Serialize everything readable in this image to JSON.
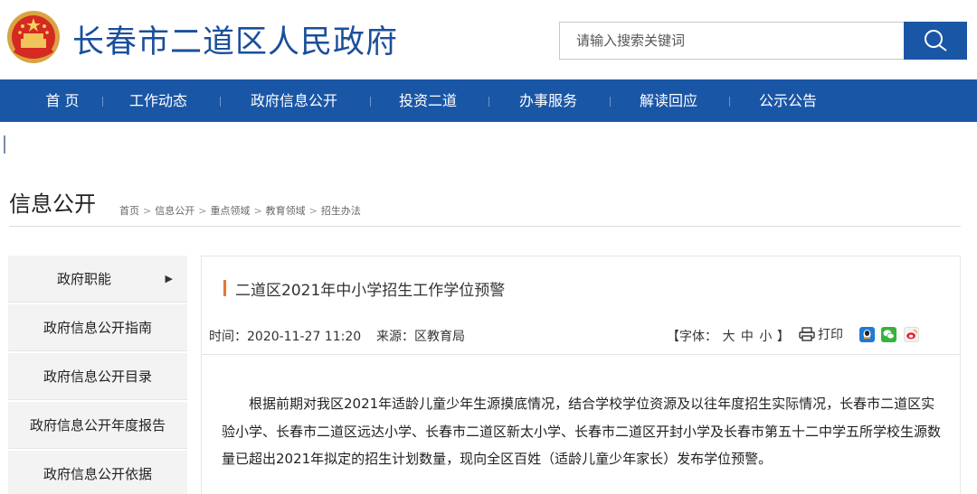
{
  "header": {
    "site_title": "长春市二道区人民政府",
    "search_placeholder": "请输入搜索关键词"
  },
  "nav": [
    {
      "label": "首 页"
    },
    {
      "label": "工作动态"
    },
    {
      "label": "政府信息公开"
    },
    {
      "label": "投资二道"
    },
    {
      "label": "办事服务"
    },
    {
      "label": "解读回应"
    },
    {
      "label": "公示公告"
    }
  ],
  "section": {
    "title": "信息公开",
    "breadcrumb": [
      "首页",
      "信息公开",
      "重点领域",
      "教育领域",
      "招生办法"
    ],
    "breadcrumb_sep": ">"
  },
  "sidebar": [
    {
      "label": "政府职能",
      "arrow": "▶"
    },
    {
      "label": "政府信息公开指南"
    },
    {
      "label": "政府信息公开目录"
    },
    {
      "label": "政府信息公开年度报告"
    },
    {
      "label": "政府信息公开依据"
    }
  ],
  "article": {
    "title": "二道区2021年中小学招生工作学位预警",
    "time": "时间：2020-11-27 11:20",
    "source": "来源：区教育局",
    "font_prefix": "【字体：",
    "font_large": "大",
    "font_medium": "中",
    "font_small": "小",
    "font_suffix": "】",
    "print_label": "打印",
    "body": "根据前期对我区2021年适龄儿童少年生源摸底情况，结合学校学位资源及以往年度招生实际情况，长春市二道区实验小学、长春市二道区远达小学、长春市二道区新太小学、长春市二道区开封小学及长春市第五十二中学五所学校生源数量已超出2021年拟定的招生计划数量，现向全区百姓（适龄儿童少年家长）发布学位预警。"
  },
  "icons": {
    "emblem": "national-emblem-icon",
    "search": "search-icon",
    "print": "printer-icon",
    "share_qq": "qq-icon",
    "share_wechat": "wechat-icon",
    "share_weibo": "weibo-icon"
  },
  "colors": {
    "brand_blue": "#1a56a6",
    "title_blue": "#1a4f9c",
    "accent_orange": "#e8772e"
  }
}
